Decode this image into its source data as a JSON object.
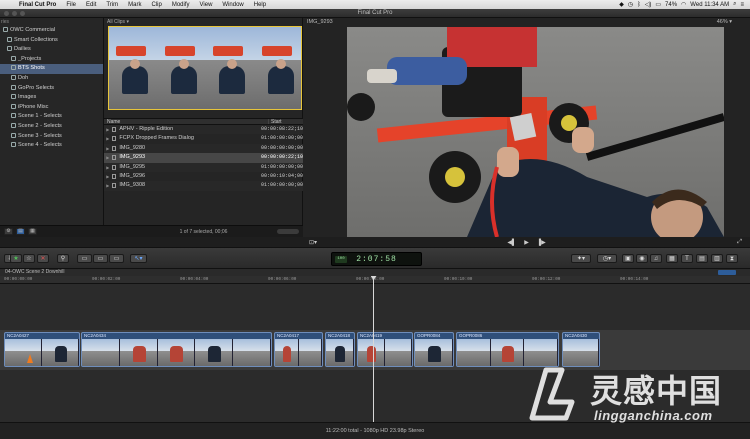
{
  "menubar": {
    "app": "Final Cut Pro",
    "items": [
      "File",
      "Edit",
      "Trim",
      "Mark",
      "Clip",
      "Modify",
      "View",
      "Window",
      "Help"
    ],
    "battery": "74%",
    "clock": "Wed 11:34 AM"
  },
  "window": {
    "title": "Final Cut Pro"
  },
  "library": {
    "header": "ries",
    "items": [
      {
        "label": "OWC Commercial",
        "level": 0,
        "selected": false
      },
      {
        "label": "Smart Collections",
        "level": 1,
        "selected": false
      },
      {
        "label": "Dailies",
        "level": 1,
        "selected": false
      },
      {
        "label": "_Projects",
        "level": 2,
        "selected": false
      },
      {
        "label": "BTS Shots",
        "level": 2,
        "selected": true
      },
      {
        "label": "Doh",
        "level": 2,
        "selected": false
      },
      {
        "label": "GoPro Selects",
        "level": 2,
        "selected": false
      },
      {
        "label": "Images",
        "level": 2,
        "selected": false
      },
      {
        "label": "iPhone Misc",
        "level": 2,
        "selected": false
      },
      {
        "label": "Scene 1 - Selects",
        "level": 2,
        "selected": false
      },
      {
        "label": "Scene 2 - Selects",
        "level": 2,
        "selected": false
      },
      {
        "label": "Scene 3 - Selects",
        "level": 2,
        "selected": false
      },
      {
        "label": "Scene 4 - Selects",
        "level": 2,
        "selected": false
      }
    ]
  },
  "browser": {
    "filter": "All Clips ▾",
    "columns": {
      "name": "Name",
      "start": "Start"
    },
    "clips": [
      {
        "name": "APHV - Ripple Edition",
        "start": "00:00:08:22;10",
        "selected": false
      },
      {
        "name": "FCPX Dropped Frames Dialog",
        "start": "01:00:00:00;00",
        "selected": false
      },
      {
        "name": "IMG_9280",
        "start": "00:00:00:00;00",
        "selected": false
      },
      {
        "name": "IMG_9293",
        "start": "00:00:00:22;10",
        "selected": true
      },
      {
        "name": "IMG_9295",
        "start": "01:00:00:00;00",
        "selected": false
      },
      {
        "name": "IMG_9296",
        "start": "00:00:10:04;00",
        "selected": false
      },
      {
        "name": "IMG_9308",
        "start": "01:00:00:00;00",
        "selected": false
      }
    ],
    "footer": "1 of 7 selected, 00;06"
  },
  "viewer": {
    "clip_name": "IMG_9293",
    "zoom": "46% ▾"
  },
  "toolbar": {
    "timecode": "2:07:58",
    "timecode_mode": "100"
  },
  "timeline": {
    "project": "04-OWC Scene 2 Downhill",
    "ruler": [
      "00:00:00:00",
      "00:00:02:00",
      "00:00:04:00",
      "00:00:06:00",
      "00:00:08:00",
      "00:00:10:00",
      "00:00:12:00",
      "00:00:14:00"
    ],
    "clips": [
      {
        "label": "NC2A0427",
        "thumbs": [
          "cone",
          "dark"
        ]
      },
      {
        "label": "NC2A0434",
        "thumbs": [
          "plain",
          "red",
          "red",
          "dark",
          "plain"
        ]
      },
      {
        "label": "NC2A0417",
        "thumbs": [
          "red",
          "plain"
        ]
      },
      {
        "label": "NC2A0418",
        "thumbs": [
          "dark"
        ]
      },
      {
        "label": "NC2A0419",
        "thumbs": [
          "red",
          "plain"
        ]
      },
      {
        "label": "GOPR0084",
        "thumbs": [
          "dark"
        ]
      },
      {
        "label": "GOPR0086",
        "thumbs": [
          "plain",
          "red",
          "plain"
        ]
      },
      {
        "label": "NC2A0430",
        "thumbs": [
          "plain"
        ]
      }
    ]
  },
  "status": "11:22:00 total - 1080p HD 23.98p Stereo",
  "watermark": {
    "cn": "灵感中国",
    "url": "lingganchina.com"
  }
}
